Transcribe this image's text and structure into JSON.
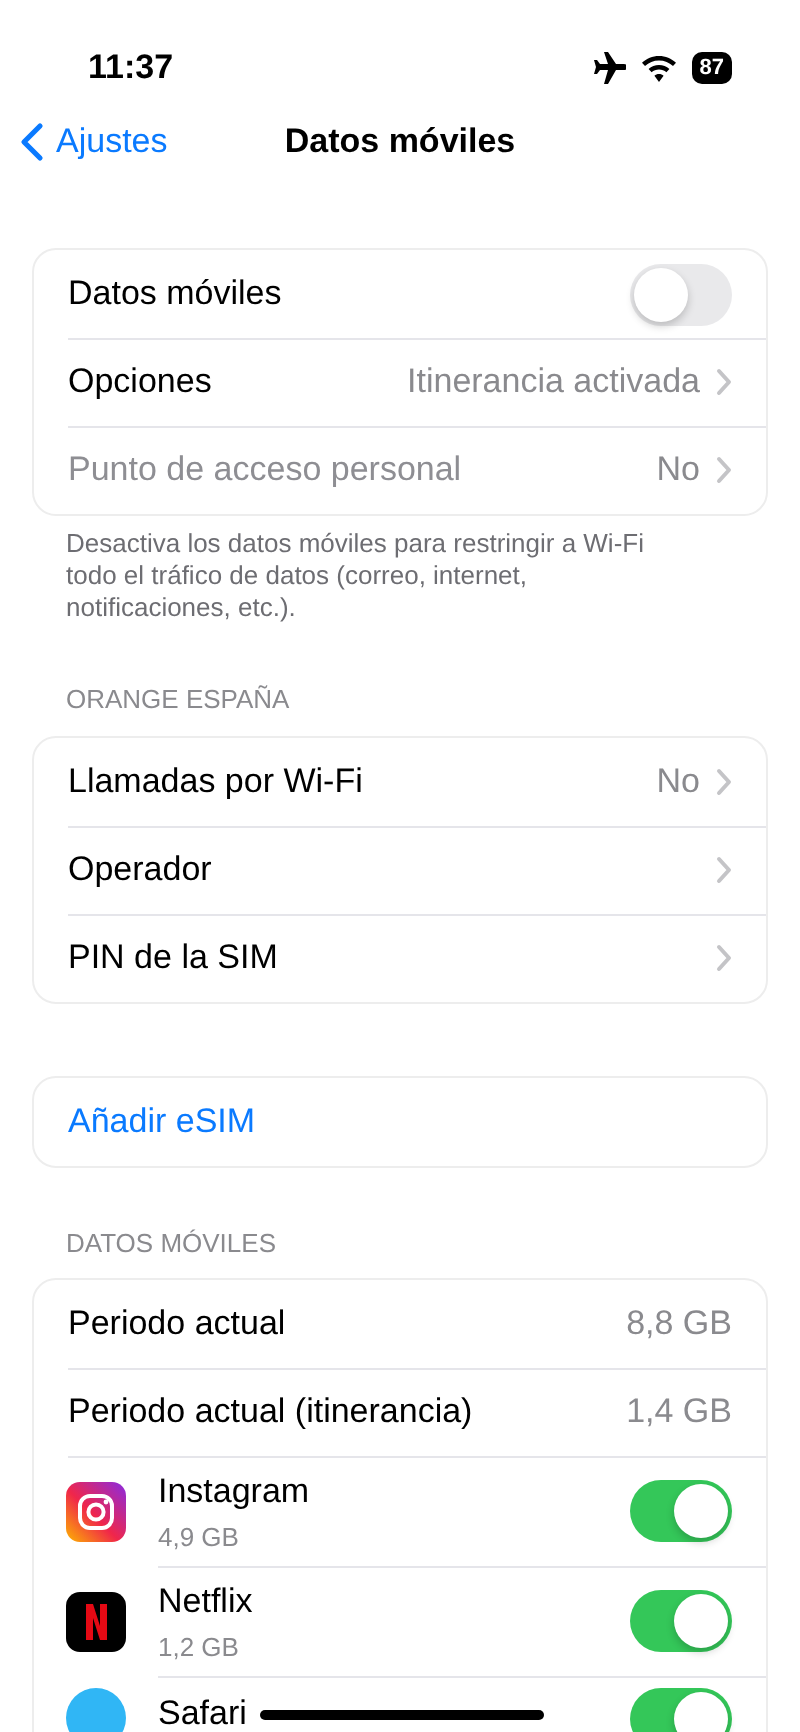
{
  "status_bar": {
    "time": "11:37",
    "battery": "87"
  },
  "nav": {
    "back": "Ajustes",
    "title": "Datos móviles"
  },
  "sections": [
    {
      "rows": [
        {
          "kind": "toggle",
          "label": "Datos móviles",
          "on": false,
          "disabled": false
        },
        {
          "kind": "disclosure",
          "label": "Opciones",
          "value": "Itinerancia activada",
          "disabled": false
        },
        {
          "kind": "disclosure",
          "label": "Punto de acceso personal",
          "value": "No",
          "disabled": true
        }
      ],
      "footer": "Desactiva los datos móviles para restringir a Wi-Fi todo el tráfico de datos (correo, internet, notificaciones, etc.)."
    },
    {
      "header": "ORANGE ESPAÑA",
      "rows": [
        {
          "kind": "disclosure",
          "label": "Llamadas por Wi-Fi",
          "value": "No",
          "disabled": false
        },
        {
          "kind": "disclosure",
          "label": "Operador",
          "disabled": false
        },
        {
          "kind": "disclosure",
          "label": "PIN de la SIM",
          "disabled": false
        }
      ]
    },
    {
      "rows": [
        {
          "kind": "action",
          "label": "Añadir eSIM"
        }
      ]
    },
    {
      "header": "DATOS MÓVILES",
      "rows": [
        {
          "kind": "stat",
          "label": "Periodo actual",
          "value": "8,8 GB"
        },
        {
          "kind": "stat",
          "label": "Periodo actual (itinerancia)",
          "value": "1,4 GB"
        },
        {
          "kind": "app",
          "label": "Instagram",
          "detail": "4,9 GB",
          "on": true
        },
        {
          "kind": "app",
          "label": "Netflix",
          "detail": "1,2 GB",
          "on": true
        },
        {
          "kind": "app",
          "label": "Safari",
          "on": true
        }
      ]
    }
  ]
}
